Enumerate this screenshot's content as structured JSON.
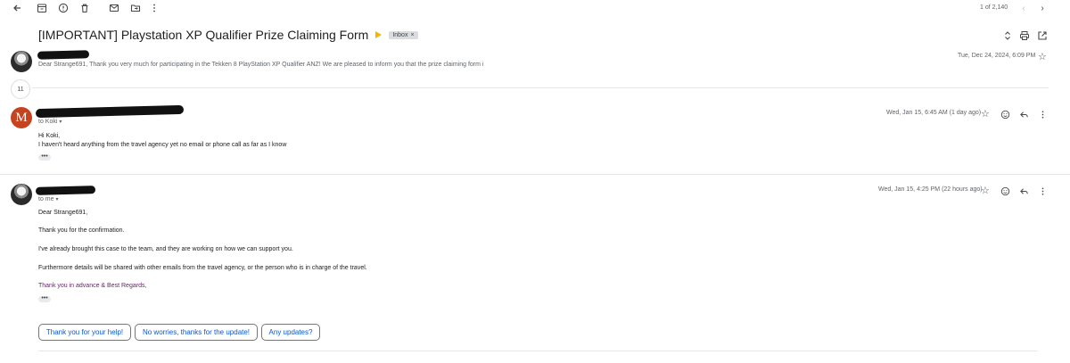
{
  "toolbar": {
    "back_icon": "arrow-left-icon",
    "archive_icon": "archive-icon",
    "spam_icon": "report-spam-icon",
    "delete_icon": "trash-icon",
    "mark_unread_icon": "mail-icon",
    "move_icon": "folder-move-icon",
    "more_icon": "more-vertical-icon",
    "page_count": "1 of 2,140",
    "prev_icon": "chevron-left-icon",
    "next_icon": "chevron-right-icon"
  },
  "thread": {
    "subject": "[IMPORTANT] Playstation XP Qualifier Prize Claiming Form",
    "label": "Inbox",
    "label_remove": "×",
    "important_marker_color": "#f2b705"
  },
  "messages": [
    {
      "avatar_letter": "",
      "timestamp": "Tue, Dec 24, 2024, 6:09 PM",
      "snippet": "Dear Strange691, Thank you very much for participating in the Tekken 8 PlayStation XP Qualifier ANZ! We are pleased to inform you that the prize claiming form i"
    },
    {
      "avatar_letter": "M",
      "avatar_color": "#c5431f",
      "to": "to Koki",
      "timestamp": "Wed, Jan 15, 6:45 AM (1 day ago)",
      "body": [
        "Hi Koki,",
        "I haven't heard anything from the travel agency yet no email or phone call as far as I know"
      ]
    },
    {
      "avatar_letter": "",
      "to": "to me",
      "timestamp": "Wed, Jan 15, 4:25 PM (22 hours ago)",
      "body": [
        "Dear Strange691,",
        "Thank you for the confirmation.",
        "I've already brought this case to the team, and they are working on how we can support you.",
        "Furthermore details will be shared with other emails from the travel agency, or the person who is in charge of the travel.",
        "Thank you in advance & Best Regards,"
      ]
    }
  ],
  "collapsed_count": "11",
  "ellipsis": "•••",
  "smart_replies": [
    "Thank you for your help!",
    "No worries, thanks for the update!",
    "Any updates?"
  ]
}
